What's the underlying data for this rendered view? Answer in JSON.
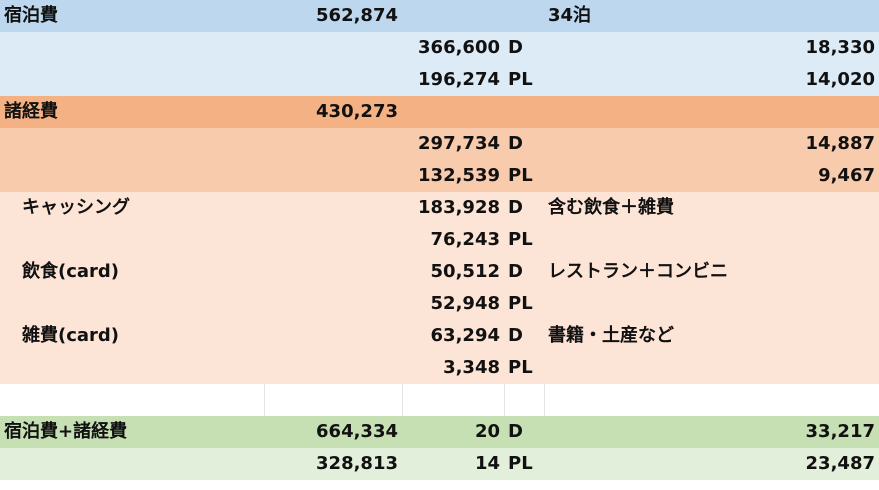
{
  "lodging": {
    "label": "宿泊費",
    "total": "562,874",
    "nights": "34泊",
    "d_amount": "366,600",
    "d_unit": "D",
    "d_per": "18,330",
    "pl_amount": "196,274",
    "pl_unit": "PL",
    "pl_per": "14,020"
  },
  "misc": {
    "label": "諸経費",
    "total": "430,273",
    "d_amount": "297,734",
    "d_unit": "D",
    "d_per": "14,887",
    "pl_amount": "132,539",
    "pl_unit": "PL",
    "pl_per": "9,467"
  },
  "cashing": {
    "label": "キャッシング",
    "d_amount": "183,928",
    "d_unit": "D",
    "note": "含む飲食＋雑費",
    "pl_amount": "76,243",
    "pl_unit": "PL"
  },
  "food": {
    "label": "飲食(card)",
    "d_amount": "50,512",
    "d_unit": "D",
    "note": "レストラン＋コンビニ",
    "pl_amount": "52,948",
    "pl_unit": "PL"
  },
  "sundry": {
    "label": "雑費(card)",
    "d_amount": "63,294",
    "d_unit": "D",
    "note": "書籍・土産など",
    "pl_amount": "3,348",
    "pl_unit": "PL"
  },
  "combined": {
    "label": "宿泊費+諸経費",
    "d_total": "664,334",
    "d_days": "20",
    "d_unit": "D",
    "d_per": "33,217",
    "pl_total": "328,813",
    "pl_days": "14",
    "pl_unit": "PL",
    "pl_per": "23,487"
  }
}
